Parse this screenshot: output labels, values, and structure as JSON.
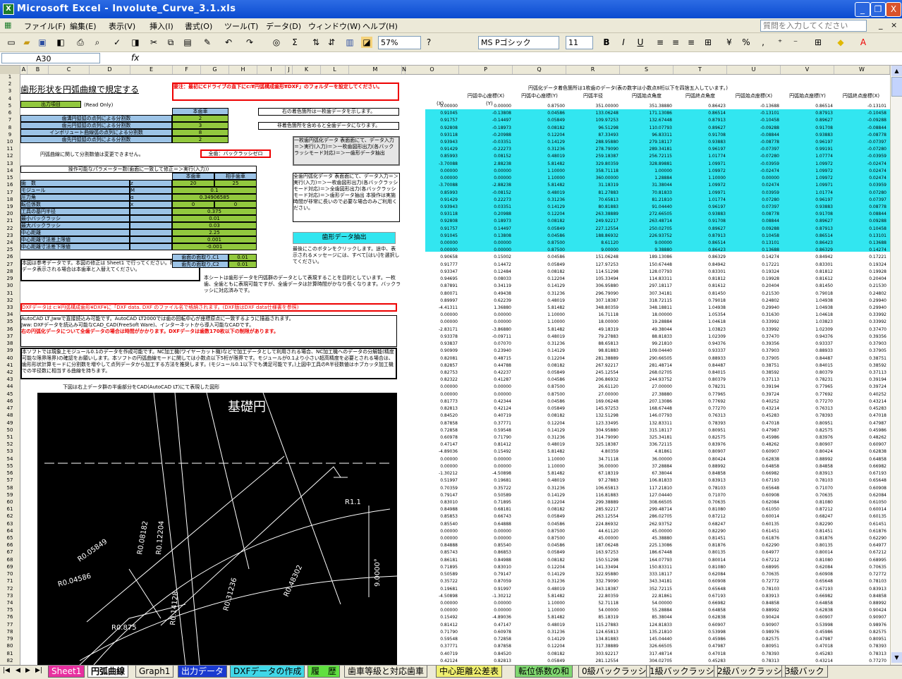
{
  "window": {
    "title": "Microsoft Excel - Involute_Curve_3.1.xls",
    "min": "_",
    "restore": "❐",
    "close": "X"
  },
  "menu": {
    "items": [
      "ファイル(F)",
      "編集(E)",
      "表示(V)",
      "挿入(I)",
      "書式(O)",
      "ツール(T)",
      "データ(D)",
      "ウィンドウ(W)",
      "ヘルプ(H)"
    ],
    "help_placeholder": "質問を入力してください"
  },
  "toolbar": {
    "zoom": "57%",
    "font": "MS Pゴシック",
    "size": "11",
    "bold": "B",
    "italic": "I",
    "underline": "U"
  },
  "formula": {
    "name_box": "A30",
    "fx": "fx"
  },
  "columns": [
    "A",
    "B",
    "C",
    "D",
    "E",
    "F",
    "G",
    "H",
    "I",
    "J",
    "K",
    "L",
    "M",
    "N",
    "O",
    "P",
    "Q",
    "R",
    "S",
    "T",
    "U",
    "V",
    "W"
  ],
  "rows_start": 1,
  "rows_end": 82,
  "sheet": {
    "title": "歯形形状を円弧曲線で規定する",
    "legend_label": "出力項目",
    "legend_note": "(Read Only)",
    "warning": "要注：最初にCドライブの直下にc:¥円弧構成歯形¥DXF」のフォルダーを設定してください。",
    "hon_haguruma": "本歯車",
    "counts": [
      {
        "label": "歯溝円弧弧の点列による分割数",
        "value": "2"
      },
      {
        "label": "歯元円弧弧の点列による分割数",
        "value": "3"
      },
      {
        "label": "インボリュート曲線弧の点列による分割数",
        "value": "8"
      },
      {
        "label": "歯先円弧弧の点列による分割数",
        "value": "2"
      }
    ],
    "arc_note": "円弧曲線に関して分割数値は変更できません。",
    "backlash_zero": "全歯：バックラッシゼロ",
    "note_right1": "右の着色箇所は一枚歯データを示します。",
    "note_right2": "非着色箇所を含めると全歯データになります。",
    "box_single": "一枚歯円弧化データ 表面面にて、データ入力＝＞実行(入力)＝＞一枚歯図形出力(各バックラッシモード対応)＝＞一歯形データ抽出",
    "box_all": "全歯円弧化データ 表面面にて、データ入力＝＞実行(入力)＝＞一枚歯図形出力(各バックラッシモード対応)＝＞全歯図形出力(各バックラッシモード対応)＝＞歯形データ抽出 本操作は実施時間が非常に長いので必要な場合のみご利用ください。",
    "param_header": "操作可能なパラメーター数(歯面に一致して修正＝＞実行(入力))",
    "col_hon": "本歯車",
    "col_aite": "相手歯車",
    "params": [
      {
        "label": "歯　数",
        "sym": "z",
        "v1": "20",
        "v2": "25"
      },
      {
        "label": "モジュール",
        "sym": "M",
        "v1": "0.1",
        "v2": ""
      },
      {
        "label": "圧力角",
        "sym": "α",
        "v1": "0.34906585",
        "v2": ""
      },
      {
        "label": "転位係数",
        "sym": "x",
        "v1": "0",
        "v2": "0"
      },
      {
        "label": "工具の基円半径",
        "sym": "",
        "v1": "0.375",
        "v2": ""
      },
      {
        "label": "最小バックラッシ",
        "sym": "",
        "v1": "0.01",
        "v2": ""
      },
      {
        "label": "最大バックラッシ",
        "sym": "",
        "v1": "0.03",
        "v2": ""
      },
      {
        "label": "中心距離",
        "sym": "",
        "v1": "2.25",
        "v2": ""
      },
      {
        "label": "中心距離寸法差上限値",
        "sym": "",
        "v1": "0.001",
        "v2": ""
      },
      {
        "label": "中心距離寸法差下限値",
        "sym": "",
        "v1": "-0.001",
        "v2": ""
      }
    ],
    "chamfer": [
      {
        "label": "歯面の面取り,C1",
        "v": "0.01"
      },
      {
        "label": "歯先の面取り,C2",
        "v": "0.01"
      }
    ],
    "extract_button": "歯形データ抽出",
    "extract_note": "最後にこのボタンをクリックします。途中、表示されるメッセージには、すべて[はい]を選択してください。",
    "ref_note": "本図は参考データです。本図の修正は Sheet1 で行ってください。相手歯車のデータ表示される場合は本歯車と入替えてください。",
    "sheet_note": "本シートは歯形データを円弧群のデータとして表現することを目的としています。一枚歯、全歯ともに表現可能ですが、全歯データは計算時間がかなり長くなります。バックラッシに対応済みです。",
    "dxf_line": "DXFデータは c:¥円弧構成歯形¥DXF¥に「DXF data. DXF のファイル名で格納されます。(DXF版はDXF data仕様書を参照)",
    "cad_note1": "AutoCAD LT,Jwwで直接読込み可能です。AutoCAD LT2000では歯の回転中心が座標原点に一致するように描画されます。",
    "cad_note2": "Jww: DXFデータを読込み可能なCAD_CAD(FreeSoft Ware)、インターネットから導入可能なCADです。",
    "limit_note": "右の円弧化データについて全歯データの場合は時間がかかります。DXFデータは歯数170枚以下の制限があります。",
    "long_note": "本ソフトでは現象上モジュール0.1のデータを作成可能です。NC加工機(ワイヤーカット機)などで加工データとして利用される場合、NC加工機へのデータの分解能(精度可能な限界限界)の確認をお願いします。本ソフトの円弧曲線モードに関しては小数点以下5桁が限界です。モジュールが0.1より小さい超高精度を必要とされる場合は、歯形形状計算モードに分割数を増やして点列データから加工する方法を推奨します。(モジュール0.1以下でも満足可能です。)上図中工具のR半径数値はホブカッタ加工機での半径数に相当する曲線を持ちます。",
    "cad_caption": "下図は右上データ群の半歯部分をCAD(AutoCAD LT)にて表現した図形"
  },
  "cad_labels": {
    "kisoen": "基礎円",
    "r1": "R1.1",
    "r2": "R0.08182",
    "r3": "R0.12204",
    "r4": "R0.05849",
    "r5": "R0.04586",
    "r6": "R0.875",
    "r7": "R0.14128",
    "r8": "R0.31236",
    "r9": "R0.48302",
    "ang": "9.0000°"
  },
  "data_header": {
    "title": "円弧化データ着色箇所は1枚歯のデータ(表の数字は小数点8桁以下を四捨五入しています。)",
    "cols": [
      "円弧中心座標(X)",
      "円弧中心座標(Y)",
      "円弧半径",
      "円弧始点角度",
      "円弧終点角度",
      "円弧始点座標(X)",
      "円弧始点座標(Y)",
      "円弧終点座標(X)",
      "円弧終点座標(Y)"
    ],
    "unit_x": "(X)",
    "unit_y": "(Y)"
  },
  "data_rows": [
    [
      "0.00000",
      "0.00000",
      "0.87500",
      "351.00000",
      "351.38880",
      "0.86423",
      "-0.13688",
      "0.86514",
      "-0.13101"
    ],
    [
      "0.91045",
      "-0.13808",
      "0.04586",
      "133.06248",
      "171.13086",
      "0.86514",
      "-0.13101",
      "0.87913",
      "-0.10458"
    ],
    [
      "0.91757",
      "-0.14497",
      "0.05849",
      "109.97253",
      "132.67448",
      "0.87913",
      "-0.10458",
      "0.89627",
      "-0.09288"
    ],
    [
      "0.92808",
      "-0.18973",
      "0.08182",
      "96.51298",
      "110.07793",
      "0.89627",
      "-0.09288",
      "0.91708",
      "-0.08844"
    ],
    [
      "0.93118",
      "-0.20988",
      "0.12204",
      "87.33493",
      "96.83311",
      "0.91708",
      "-0.08844",
      "0.93883",
      "-0.08778"
    ],
    [
      "0.93943",
      "-0.03351",
      "0.14129",
      "288.95880",
      "279.18117",
      "0.93883",
      "-0.08778",
      "0.96197",
      "-0.07397"
    ],
    [
      "0.91429",
      "-0.22273",
      "0.31236",
      "278.79090",
      "289.34181",
      "0.96197",
      "-0.07397",
      "0.99191",
      "-0.07280"
    ],
    [
      "0.85993",
      "0.08152",
      "0.48019",
      "259.18387",
      "256.72115",
      "1.01774",
      "-0.07280",
      "1.07774",
      "-0.03959"
    ],
    [
      "-3.70088",
      "2.88238",
      "5.81482",
      "329.80359",
      "328.89881",
      "1.09971",
      "-0.03959",
      "1.09972",
      "-0.02474"
    ],
    [
      "0.00000",
      "0.00000",
      "1.10000",
      "358.71118",
      "1.00000",
      "1.09972",
      "-0.02474",
      "1.09972",
      "0.02474"
    ],
    [
      "0.00000",
      "0.00000",
      "1.10000",
      "360.00000",
      "1.28884",
      "1.10000",
      "0.00000",
      "1.09972",
      "0.02474"
    ],
    [
      "-3.70088",
      "-2.88238",
      "5.81482",
      "31.18319",
      "31.38044",
      "1.09972",
      "0.02474",
      "1.09971",
      "0.03959"
    ],
    [
      "0.85993",
      "-0.08152",
      "0.48019",
      "81.27883",
      "70.81833",
      "1.09971",
      "0.03959",
      "1.01774",
      "0.07280"
    ],
    [
      "0.91429",
      "0.22273",
      "0.31236",
      "70.65813",
      "81.21810",
      "1.01774",
      "0.07280",
      "0.96197",
      "0.07397"
    ],
    [
      "0.93943",
      "0.03351",
      "0.14129",
      "80.81883",
      "91.04440",
      "0.96197",
      "0.07397",
      "0.93883",
      "0.08778"
    ],
    [
      "0.93118",
      "0.20988",
      "0.12204",
      "263.38889",
      "272.66505",
      "0.93883",
      "0.08778",
      "0.91708",
      "0.08844"
    ],
    [
      "0.92808",
      "0.18973",
      "0.08182",
      "249.92217",
      "263.48714",
      "0.91708",
      "0.08844",
      "0.89627",
      "0.09288"
    ],
    [
      "0.91757",
      "0.14497",
      "0.05849",
      "227.12554",
      "250.02705",
      "0.89627",
      "0.09288",
      "0.87913",
      "0.10458"
    ],
    [
      "0.91045",
      "0.13808",
      "0.04586",
      "188.86932",
      "226.93752",
      "0.87913",
      "0.10458",
      "0.86514",
      "0.13101"
    ],
    [
      "0.00000",
      "0.00000",
      "0.87500",
      "8.61120",
      "9.00000",
      "0.86514",
      "0.13101",
      "0.86423",
      "0.13688"
    ],
    [
      "0.00000",
      "0.00000",
      "0.87500",
      "9.00000",
      "9.38880",
      "0.86423",
      "0.13688",
      "0.86329",
      "0.14274"
    ],
    [
      "0.90658",
      "0.15002",
      "0.04586",
      "151.06248",
      "189.13086",
      "0.86329",
      "0.14274",
      "0.84942",
      "0.17221"
    ],
    [
      "0.91777",
      "0.14472",
      "0.05849",
      "127.97253",
      "150.67448",
      "0.84942",
      "0.17221",
      "0.83301",
      "0.19324"
    ],
    [
      "0.93347",
      "0.12484",
      "0.08182",
      "114.51298",
      "128.07793",
      "0.83301",
      "0.19324",
      "0.81812",
      "0.19928"
    ],
    [
      "0.94695",
      "0.08033",
      "0.12204",
      "105.33494",
      "114.83311",
      "0.81812",
      "0.19928",
      "0.81612",
      "0.20404"
    ],
    [
      "0.87891",
      "0.34119",
      "0.14129",
      "306.95880",
      "297.18117",
      "0.81612",
      "0.20404",
      "0.81450",
      "0.21530"
    ],
    [
      "0.80071",
      "0.49438",
      "0.31236",
      "296.79090",
      "307.34181",
      "0.81450",
      "0.21530",
      "0.79018",
      "0.24802"
    ],
    [
      "0.89997",
      "0.62239",
      "0.48019",
      "307.18387",
      "318.72115",
      "0.79018",
      "0.24802",
      "1.04938",
      "0.29940"
    ],
    [
      "-4.41311",
      "1.36880",
      "5.81482",
      "348.80359",
      "348.18811",
      "1.04938",
      "0.29940",
      "1.04938",
      "0.29940"
    ],
    [
      "0.00000",
      "0.00000",
      "1.10000",
      "16.71118",
      "18.00000",
      "1.05354",
      "0.31630",
      "1.04618",
      "0.33992"
    ],
    [
      "0.00000",
      "0.00000",
      "1.10000",
      "18.00000",
      "19.28884",
      "1.04618",
      "0.33992",
      "1.03823",
      "0.33992"
    ],
    [
      "-2.83171",
      "-3.86880",
      "5.81482",
      "49.18319",
      "49.38044",
      "1.03823",
      "0.33992",
      "1.02309",
      "0.37470"
    ],
    [
      "0.93378",
      "-0.09711",
      "0.48019",
      "79.27883",
      "88.81833",
      "1.02309",
      "0.37470",
      "0.94376",
      "0.39356"
    ],
    [
      "0.93837",
      "0.07070",
      "0.31236",
      "88.65813",
      "99.21810",
      "0.94376",
      "0.39356",
      "0.93337",
      "0.37903"
    ],
    [
      "0.90909",
      "0.23940",
      "0.14129",
      "98.81883",
      "109.04440",
      "0.93337",
      "0.37903",
      "0.88933",
      "0.37905"
    ],
    [
      "0.82081",
      "0.48715",
      "0.12204",
      "281.38889",
      "290.66505",
      "0.88933",
      "0.37905",
      "0.84487",
      "0.38751"
    ],
    [
      "0.82857",
      "0.44788",
      "0.08182",
      "267.92217",
      "281.48714",
      "0.84487",
      "0.38751",
      "0.84015",
      "0.38592"
    ],
    [
      "0.82753",
      "0.42237",
      "0.05849",
      "245.12554",
      "268.02705",
      "0.84015",
      "0.38592",
      "0.80379",
      "0.37113"
    ],
    [
      "0.82322",
      "0.41287",
      "0.04586",
      "206.86932",
      "244.93752",
      "0.80379",
      "0.37113",
      "0.78231",
      "0.39194"
    ],
    [
      "0.00000",
      "0.00000",
      "0.87500",
      "26.61120",
      "27.00000",
      "0.78231",
      "0.39194",
      "0.77965",
      "0.39724"
    ],
    [
      "0.00000",
      "0.00000",
      "0.87500",
      "27.00000",
      "27.38880",
      "0.77965",
      "0.39724",
      "0.77692",
      "0.40252"
    ],
    [
      "0.81773",
      "0.42344",
      "0.04586",
      "169.06248",
      "207.13086",
      "0.77692",
      "0.40252",
      "0.77270",
      "0.43214"
    ],
    [
      "0.82813",
      "0.42124",
      "0.05849",
      "145.97253",
      "168.67448",
      "0.77270",
      "0.43214",
      "0.76313",
      "0.45283"
    ],
    [
      "0.84520",
      "0.40719",
      "0.08182",
      "132.51298",
      "146.07793",
      "0.76313",
      "0.45283",
      "0.78393",
      "0.47018"
    ],
    [
      "0.87858",
      "0.37771",
      "0.12204",
      "123.33495",
      "132.83311",
      "0.78393",
      "0.47018",
      "0.80951",
      "0.47987"
    ],
    [
      "0.72858",
      "0.59548",
      "0.14129",
      "304.95880",
      "315.18117",
      "0.80951",
      "0.47987",
      "0.82575",
      "0.45986"
    ],
    [
      "0.60978",
      "0.71790",
      "0.31236",
      "314.79090",
      "325.34181",
      "0.82575",
      "0.45986",
      "0.83976",
      "0.48262"
    ],
    [
      "0.47147",
      "0.81412",
      "0.48019",
      "325.18387",
      "336.72115",
      "0.83976",
      "0.48262",
      "0.80907",
      "0.60907"
    ],
    [
      "-4.89036",
      "0.15492",
      "5.81482",
      "4.80359",
      "4.81861",
      "0.80907",
      "0.60907",
      "0.80424",
      "0.62838"
    ],
    [
      "0.00000",
      "0.00000",
      "1.10000",
      "34.71118",
      "36.00000",
      "0.80424",
      "0.62838",
      "0.88992",
      "0.64858"
    ],
    [
      "0.00000",
      "0.00000",
      "1.10000",
      "36.00000",
      "37.28884",
      "0.88992",
      "0.64858",
      "0.84858",
      "0.66982"
    ],
    [
      "-1.30212",
      "-4.50898",
      "5.81482",
      "67.18319",
      "67.38044",
      "0.84858",
      "0.66982",
      "0.83913",
      "0.67193"
    ],
    [
      "0.51997",
      "0.19681",
      "0.48019",
      "97.27883",
      "106.81833",
      "0.83913",
      "0.67193",
      "0.78103",
      "0.65648"
    ],
    [
      "0.70359",
      "0.35722",
      "0.31236",
      "106.65813",
      "117.21810",
      "0.78103",
      "0.65648",
      "0.71070",
      "0.60908"
    ],
    [
      "0.79147",
      "0.50589",
      "0.14129",
      "116.81883",
      "127.04440",
      "0.71070",
      "0.60908",
      "0.70635",
      "0.62084"
    ],
    [
      "0.83010",
      "0.71895",
      "0.12204",
      "299.38889",
      "308.66505",
      "0.70635",
      "0.62084",
      "0.81080",
      "0.61050"
    ],
    [
      "0.84988",
      "0.68181",
      "0.08182",
      "285.92217",
      "299.48714",
      "0.81080",
      "0.61050",
      "0.87212",
      "0.60014"
    ],
    [
      "0.85853",
      "0.66743",
      "0.05849",
      "263.12554",
      "286.02705",
      "0.87212",
      "0.60014",
      "0.68247",
      "0.60135"
    ],
    [
      "0.85540",
      "0.64888",
      "0.04586",
      "224.86932",
      "262.93752",
      "0.68247",
      "0.60135",
      "0.82290",
      "0.61451"
    ],
    [
      "0.00000",
      "0.00000",
      "0.87500",
      "44.61120",
      "45.00000",
      "0.82290",
      "0.61451",
      "0.81451",
      "0.61876"
    ],
    [
      "0.00000",
      "0.00000",
      "0.87500",
      "45.00000",
      "45.38880",
      "0.81451",
      "0.61876",
      "0.81876",
      "0.62290"
    ],
    [
      "0.84888",
      "0.85540",
      "0.04586",
      "187.06248",
      "225.13086",
      "0.81876",
      "0.62290",
      "0.80135",
      "0.64977"
    ],
    [
      "0.85743",
      "0.86853",
      "0.05849",
      "163.97253",
      "186.67448",
      "0.80135",
      "0.64977",
      "0.80014",
      "0.67212"
    ],
    [
      "0.86181",
      "0.84988",
      "0.08182",
      "150.51298",
      "164.07793",
      "0.80014",
      "0.67212",
      "0.81080",
      "0.68995"
    ],
    [
      "0.71895",
      "0.83010",
      "0.12204",
      "141.33494",
      "150.83311",
      "0.81080",
      "0.68995",
      "0.62084",
      "0.70635"
    ],
    [
      "0.50589",
      "0.79147",
      "0.14129",
      "322.95880",
      "333.18117",
      "0.62084",
      "0.70635",
      "0.60908",
      "0.72772"
    ],
    [
      "0.35722",
      "0.87059",
      "0.31236",
      "332.79090",
      "343.34181",
      "0.60908",
      "0.72772",
      "0.65648",
      "0.78103"
    ],
    [
      "0.19681",
      "0.91997",
      "0.48019",
      "343.18387",
      "352.72115",
      "0.65648",
      "0.78103",
      "0.67193",
      "0.83913"
    ],
    [
      "-4.50898",
      "-1.30212",
      "5.81482",
      "22.80359",
      "22.81861",
      "0.67193",
      "0.83913",
      "0.66982",
      "0.84858"
    ],
    [
      "0.00000",
      "0.00000",
      "1.10000",
      "52.71118",
      "54.00000",
      "0.66982",
      "0.84858",
      "0.64858",
      "0.88992"
    ],
    [
      "0.00000",
      "0.00000",
      "1.10000",
      "54.00000",
      "55.28884",
      "0.64858",
      "0.88992",
      "0.62838",
      "0.90424"
    ],
    [
      "0.15492",
      "-4.89036",
      "5.81482",
      "85.18319",
      "85.38044",
      "0.62838",
      "0.90424",
      "0.60907",
      "0.90907"
    ],
    [
      "0.81412",
      "0.47147",
      "0.48019",
      "115.27883",
      "124.81833",
      "0.60907",
      "0.90907",
      "0.53998",
      "0.98976"
    ],
    [
      "0.71790",
      "0.60978",
      "0.31236",
      "124.65813",
      "135.21810",
      "0.53998",
      "0.98976",
      "0.45986",
      "0.82575"
    ],
    [
      "0.59548",
      "0.72858",
      "0.14129",
      "134.81883",
      "145.04440",
      "0.45986",
      "0.82575",
      "0.47987",
      "0.80951"
    ],
    [
      "0.37771",
      "0.87858",
      "0.12204",
      "317.38889",
      "326.66505",
      "0.47987",
      "0.80951",
      "0.47018",
      "0.78393"
    ],
    [
      "0.40719",
      "0.84520",
      "0.08182",
      "303.92217",
      "317.48714",
      "0.47018",
      "0.78393",
      "0.45283",
      "0.78313"
    ],
    [
      "0.42124",
      "0.82813",
      "0.05849",
      "281.12554",
      "304.02705",
      "0.45283",
      "0.78313",
      "0.43214",
      "0.77270"
    ]
  ],
  "tabs": [
    "Sheet1",
    "円弧曲線",
    "Graph1",
    "出力データ",
    "DXFデータの作成",
    "履　歴",
    "歯車等級と対応歯車",
    "中心距離公差表",
    "転位係数の和",
    "0級バックラッシ",
    "1級バックラッシ",
    "2級バックラッシ",
    "3級バック"
  ]
}
